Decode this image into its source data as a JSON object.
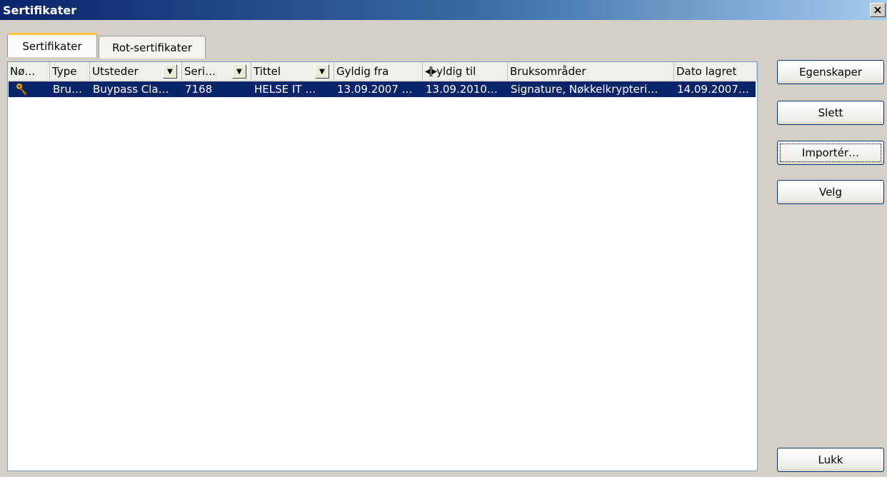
{
  "window": {
    "title": "Sertifikater",
    "close_label": "×"
  },
  "tabs": [
    {
      "label": "Sertifikater",
      "active": true
    },
    {
      "label": "Rot-sertifikater",
      "active": false
    }
  ],
  "list": {
    "columns": [
      {
        "label": "Nø…"
      },
      {
        "label": "Type"
      },
      {
        "label": "Utsteder",
        "filter": true
      },
      {
        "label": "Seri…",
        "filter": true
      },
      {
        "label": "Tittel",
        "filter": true
      },
      {
        "label": "Gyldig fra"
      },
      {
        "label": "yldig til"
      },
      {
        "label": "Bruksområder"
      },
      {
        "label": "Dato lagret"
      }
    ],
    "rows": [
      {
        "icon": "key-icon",
        "type": "Bru…",
        "utsteder": "Buypass Cla…",
        "serie": "7168",
        "tittel": "HELSE IT …",
        "gyldig_fra": "13.09.2007 …",
        "gyldig_til": "13.09.2010…",
        "bruksomrader": "Signature, Nøkkelkrypteri…",
        "dato_lagret": "14.09.2007…",
        "selected": true
      }
    ]
  },
  "buttons": {
    "properties": "Egenskaper",
    "delete": "Slett",
    "import": "Importér…",
    "select": "Velg",
    "close": "Lukk"
  },
  "colors": {
    "selection": "#0a246a",
    "title_gradient_start": "#0a246a",
    "title_gradient_end": "#a6caf0",
    "tab_highlight": "#ffc83c",
    "key_icon": "#e8b020"
  }
}
